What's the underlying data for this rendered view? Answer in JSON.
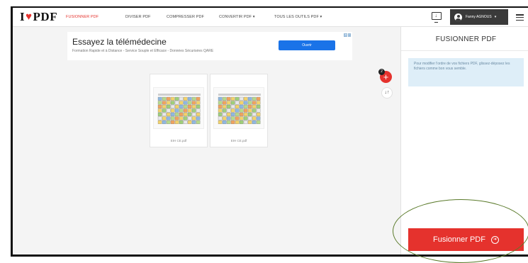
{
  "app": {
    "logo_prefix": "I",
    "logo_heart": "♥",
    "logo_suffix": "PDF",
    "accent_color": "#e5322d"
  },
  "nav": {
    "items": [
      {
        "label": "FUSIONNER PDF",
        "active": true
      },
      {
        "label": "DIVISER PDF",
        "active": false
      },
      {
        "label": "COMPRESSER PDF",
        "active": false
      },
      {
        "label": "CONVERTIR PDF ▾",
        "active": false
      },
      {
        "label": "TOUS LES OUTILS PDF ▾",
        "active": false
      }
    ],
    "desktop_icon": "desktop-download-icon",
    "user_name": "Fanny AGNOUS",
    "user_caret": "▾",
    "menu_icon": "hamburger-menu-icon"
  },
  "ad": {
    "title": "Essayez la télémédecine",
    "subtitle": "Formation Rapide et à Distance - Service Souple et Efficace - Données Sécurisées QARE",
    "button_label": "Ouvrir",
    "button_color": "#1a73e8",
    "choices_icon": "ad-choices-icon"
  },
  "files": [
    {
      "name": "EIH CE.pdf"
    },
    {
      "name": "EIH CE.pdf"
    }
  ],
  "controls": {
    "add_label": "+",
    "file_count": "2",
    "sort_label": "↓↑"
  },
  "panel": {
    "title": "FUSIONNER PDF",
    "info": "Pour modifier l'ordre de vos fichiers PDF, glissez-déposez les fichiers comme bon vous semble.",
    "info_bg": "#deeef8",
    "merge_label": "Fusionner PDF",
    "merge_icon": "arrow-circle-right-icon"
  }
}
